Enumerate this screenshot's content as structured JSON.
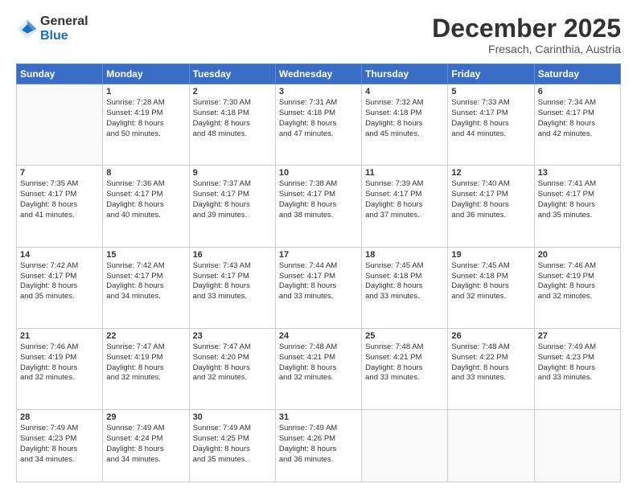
{
  "header": {
    "logo_general": "General",
    "logo_blue": "Blue",
    "month_title": "December 2025",
    "location": "Fresach, Carinthia, Austria"
  },
  "days_of_week": [
    "Sunday",
    "Monday",
    "Tuesday",
    "Wednesday",
    "Thursday",
    "Friday",
    "Saturday"
  ],
  "weeks": [
    [
      {
        "day": "",
        "text": ""
      },
      {
        "day": "1",
        "text": "Sunrise: 7:28 AM\nSunset: 4:19 PM\nDaylight: 8 hours\nand 50 minutes."
      },
      {
        "day": "2",
        "text": "Sunrise: 7:30 AM\nSunset: 4:18 PM\nDaylight: 8 hours\nand 48 minutes."
      },
      {
        "day": "3",
        "text": "Sunrise: 7:31 AM\nSunset: 4:18 PM\nDaylight: 8 hours\nand 47 minutes."
      },
      {
        "day": "4",
        "text": "Sunrise: 7:32 AM\nSunset: 4:18 PM\nDaylight: 8 hours\nand 45 minutes."
      },
      {
        "day": "5",
        "text": "Sunrise: 7:33 AM\nSunset: 4:17 PM\nDaylight: 8 hours\nand 44 minutes."
      },
      {
        "day": "6",
        "text": "Sunrise: 7:34 AM\nSunset: 4:17 PM\nDaylight: 8 hours\nand 42 minutes."
      }
    ],
    [
      {
        "day": "7",
        "text": "Sunrise: 7:35 AM\nSunset: 4:17 PM\nDaylight: 8 hours\nand 41 minutes."
      },
      {
        "day": "8",
        "text": "Sunrise: 7:36 AM\nSunset: 4:17 PM\nDaylight: 8 hours\nand 40 minutes."
      },
      {
        "day": "9",
        "text": "Sunrise: 7:37 AM\nSunset: 4:17 PM\nDaylight: 8 hours\nand 39 minutes."
      },
      {
        "day": "10",
        "text": "Sunrise: 7:38 AM\nSunset: 4:17 PM\nDaylight: 8 hours\nand 38 minutes."
      },
      {
        "day": "11",
        "text": "Sunrise: 7:39 AM\nSunset: 4:17 PM\nDaylight: 8 hours\nand 37 minutes."
      },
      {
        "day": "12",
        "text": "Sunrise: 7:40 AM\nSunset: 4:17 PM\nDaylight: 8 hours\nand 36 minutes."
      },
      {
        "day": "13",
        "text": "Sunrise: 7:41 AM\nSunset: 4:17 PM\nDaylight: 8 hours\nand 35 minutes."
      }
    ],
    [
      {
        "day": "14",
        "text": "Sunrise: 7:42 AM\nSunset: 4:17 PM\nDaylight: 8 hours\nand 35 minutes."
      },
      {
        "day": "15",
        "text": "Sunrise: 7:42 AM\nSunset: 4:17 PM\nDaylight: 8 hours\nand 34 minutes."
      },
      {
        "day": "16",
        "text": "Sunrise: 7:43 AM\nSunset: 4:17 PM\nDaylight: 8 hours\nand 33 minutes."
      },
      {
        "day": "17",
        "text": "Sunrise: 7:44 AM\nSunset: 4:17 PM\nDaylight: 8 hours\nand 33 minutes."
      },
      {
        "day": "18",
        "text": "Sunrise: 7:45 AM\nSunset: 4:18 PM\nDaylight: 8 hours\nand 33 minutes."
      },
      {
        "day": "19",
        "text": "Sunrise: 7:45 AM\nSunset: 4:18 PM\nDaylight: 8 hours\nand 32 minutes."
      },
      {
        "day": "20",
        "text": "Sunrise: 7:46 AM\nSunset: 4:19 PM\nDaylight: 8 hours\nand 32 minutes."
      }
    ],
    [
      {
        "day": "21",
        "text": "Sunrise: 7:46 AM\nSunset: 4:19 PM\nDaylight: 8 hours\nand 32 minutes."
      },
      {
        "day": "22",
        "text": "Sunrise: 7:47 AM\nSunset: 4:19 PM\nDaylight: 8 hours\nand 32 minutes."
      },
      {
        "day": "23",
        "text": "Sunrise: 7:47 AM\nSunset: 4:20 PM\nDaylight: 8 hours\nand 32 minutes."
      },
      {
        "day": "24",
        "text": "Sunrise: 7:48 AM\nSunset: 4:21 PM\nDaylight: 8 hours\nand 32 minutes."
      },
      {
        "day": "25",
        "text": "Sunrise: 7:48 AM\nSunset: 4:21 PM\nDaylight: 8 hours\nand 33 minutes."
      },
      {
        "day": "26",
        "text": "Sunrise: 7:48 AM\nSunset: 4:22 PM\nDaylight: 8 hours\nand 33 minutes."
      },
      {
        "day": "27",
        "text": "Sunrise: 7:49 AM\nSunset: 4:23 PM\nDaylight: 8 hours\nand 33 minutes."
      }
    ],
    [
      {
        "day": "28",
        "text": "Sunrise: 7:49 AM\nSunset: 4:23 PM\nDaylight: 8 hours\nand 34 minutes."
      },
      {
        "day": "29",
        "text": "Sunrise: 7:49 AM\nSunset: 4:24 PM\nDaylight: 8 hours\nand 34 minutes."
      },
      {
        "day": "30",
        "text": "Sunrise: 7:49 AM\nSunset: 4:25 PM\nDaylight: 8 hours\nand 35 minutes."
      },
      {
        "day": "31",
        "text": "Sunrise: 7:49 AM\nSunset: 4:26 PM\nDaylight: 8 hours\nand 36 minutes."
      },
      {
        "day": "",
        "text": ""
      },
      {
        "day": "",
        "text": ""
      },
      {
        "day": "",
        "text": ""
      }
    ]
  ]
}
